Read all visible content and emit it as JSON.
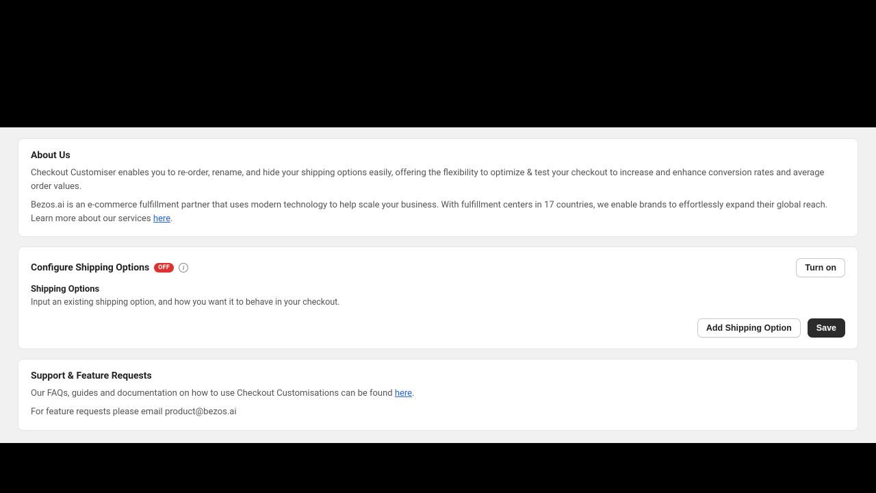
{
  "about": {
    "title": "About Us",
    "p1": "Checkout Customiser enables you to re-order, rename, and hide your shipping options easily, offering the flexibility to optimize & test your checkout to increase and enhance conversion rates and average order values.",
    "p2_prefix": "Bezos.ai is an e-commerce fulfillment partner that uses modern technology to help scale your business. With fulfillment centers in 17 countries, we enable brands to effortlessly expand their global reach. Learn more about our services ",
    "p2_link": "here",
    "p2_suffix": "."
  },
  "config": {
    "title": "Configure Shipping Options",
    "badge": "OFF",
    "turn_on_label": "Turn on",
    "sub_title": "Shipping Options",
    "sub_desc": "Input an existing shipping option, and how you want it to behave in your checkout.",
    "add_label": "Add Shipping Option",
    "save_label": "Save"
  },
  "support": {
    "title": "Support & Feature Requests",
    "p1_prefix": "Our FAQs, guides and documentation on how to use Checkout Customisations can be found ",
    "p1_link": "here",
    "p1_suffix": ".",
    "p2": "For feature requests please email product@bezos.ai"
  }
}
